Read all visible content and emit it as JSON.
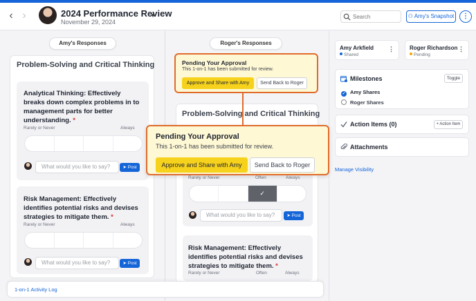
{
  "header": {
    "title": "2024 Performance Review",
    "date": "November 29, 2024",
    "search_placeholder": "Search",
    "snapshot_label": "Amy's Snapshot",
    "kebab": "⋮"
  },
  "left": {
    "pill": "Amy's Responses",
    "section_title": "Problem-Solving and Critical Thinking",
    "questions": [
      {
        "title": "Analytical Thinking: Effectively breaks down complex problems in to management parts for better understanding.",
        "scale_low": "Rarely or Never",
        "scale_high": "Always",
        "comment_placeholder": "What would you like to say?",
        "post_label": "Post"
      },
      {
        "title": "Risk Management: Effectively identifies potential risks and devises strategies to mitigate them.",
        "scale_low": "Rarely or Never",
        "scale_high": "Always",
        "comment_placeholder": "What would you like to say?",
        "post_label": "Post"
      }
    ]
  },
  "middle": {
    "pill": "Roger's Responses",
    "pending_title": "Pending Your Approval",
    "pending_desc": "This 1-on-1 has been submitted for review.",
    "approve_label": "Approve and Share with Amy",
    "sendback_label": "Send Back to Roger",
    "section_title": "Problem-Solving and Critical Thinking",
    "q1": {
      "scale_low": "Rarely or Never",
      "scale_mid": "Often",
      "scale_high": "Always",
      "selected_mark": "✓",
      "comment_placeholder": "What would you like to say?",
      "post_label": "Post"
    },
    "q2": {
      "title": "Risk Management: Effectively identifies potential risks and devises strategies to mitigate them.",
      "scale_low": "Rarely or Never",
      "scale_mid": "Often",
      "scale_high": "Always"
    }
  },
  "right": {
    "people": [
      {
        "name": "Amy Arkfield",
        "status": "Shared",
        "status_color": "#1565d8"
      },
      {
        "name": "Roger Richardson",
        "status": "Pending",
        "status_color": "#f2a900"
      }
    ],
    "milestones": {
      "title": "Milestones",
      "toggle_label": "Toggle",
      "items": [
        "Amy Shares",
        "Roger Shares"
      ]
    },
    "action_items": {
      "title": "Action Items (0)",
      "add_label": "+ Action Item"
    },
    "attachments": {
      "title": "Attachments"
    },
    "manage_visibility": "Manage Visibility"
  },
  "footer": {
    "activity_log": "1-on-1 Activity Log"
  },
  "colors": {
    "accent": "#1565d8",
    "highlight_border": "#e06a2a",
    "approve_yellow": "#f7d21c",
    "pending_bg": "#fff8d4"
  }
}
